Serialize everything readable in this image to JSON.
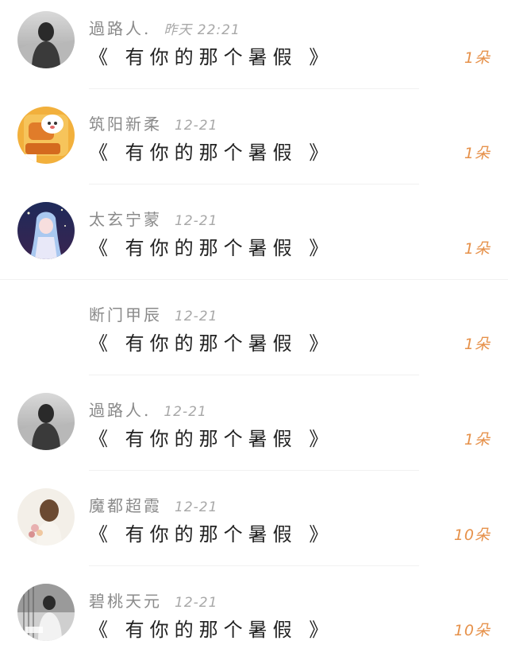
{
  "comments": [
    {
      "name": "過路人.",
      "time": "昨天 22:21",
      "title": "《 有你的那个暑假 》",
      "flowers": "1朵",
      "avatar_icon": "hooded-figure-avatar-icon"
    },
    {
      "name": "筑阳新柔",
      "time": "12-21",
      "title": "《 有你的那个暑假 》",
      "flowers": "1朵",
      "avatar_icon": "cartoon-animal-avatar-icon"
    },
    {
      "name": "太玄宁蒙",
      "time": "12-21",
      "title": "《 有你的那个暑假 》",
      "flowers": "1朵",
      "avatar_icon": "anime-girl-avatar-icon"
    },
    {
      "name": "断门甲辰",
      "time": "12-21",
      "title": "《 有你的那个暑假 》",
      "flowers": "1朵",
      "avatar_icon": ""
    },
    {
      "name": "過路人.",
      "time": "12-21",
      "title": "《 有你的那个暑假 》",
      "flowers": "1朵",
      "avatar_icon": "hooded-figure-avatar-icon"
    },
    {
      "name": "魔都超霞",
      "time": "12-21",
      "title": "《 有你的那个暑假 》",
      "flowers": "10朵",
      "avatar_icon": "girl-with-flowers-avatar-icon"
    },
    {
      "name": "碧桃天元",
      "time": "12-21",
      "title": "《 有你的那个暑假 》",
      "flowers": "10朵",
      "avatar_icon": "person-photo-avatar-icon"
    }
  ],
  "colors": {
    "name": "#8a8a8a",
    "time": "#a8a8a8",
    "title": "#222222",
    "flowers": "#e6914a",
    "divider": "#f1f1f1"
  }
}
